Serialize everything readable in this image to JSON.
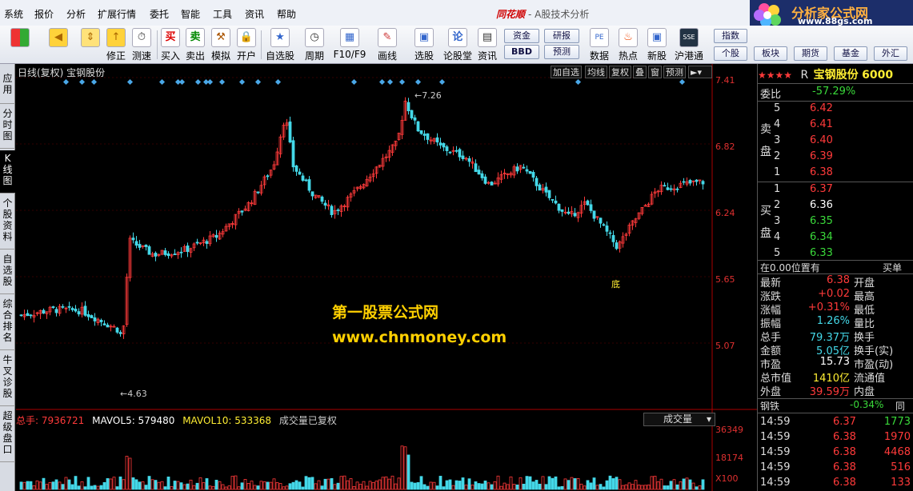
{
  "menu": [
    "系统",
    "报价",
    "分析",
    "扩展行情",
    "委托",
    "智能",
    "工具",
    "资讯",
    "帮助"
  ],
  "app_title": {
    "brand": "同花顺",
    "subtitle": "- A股技术分析"
  },
  "logo": {
    "title": "分析家公式网",
    "url": "www.88gs.com"
  },
  "toolbar": {
    "buttons": [
      {
        "label": "修正",
        "icon": "arrow-up-icon"
      },
      {
        "label": "测速",
        "icon": "stopwatch-icon"
      },
      {
        "label": "买入",
        "icon": "buy-icon"
      },
      {
        "label": "卖出",
        "icon": "sell-icon"
      },
      {
        "label": "模拟",
        "icon": "hammer-icon"
      },
      {
        "label": "开户",
        "icon": "lock-icon"
      },
      {
        "label": "自选股",
        "icon": "star-icon"
      },
      {
        "label": "周期",
        "icon": "clock-icon"
      },
      {
        "label": "F10/F9",
        "icon": "f10-icon"
      },
      {
        "label": "画线",
        "icon": "pencil-icon"
      },
      {
        "label": "选股",
        "icon": "select-stock-icon"
      },
      {
        "label": "论股堂",
        "icon": "forum-icon"
      },
      {
        "label": "资讯",
        "icon": "news-icon"
      },
      {
        "label": "数据",
        "icon": "data-icon"
      },
      {
        "label": "热点",
        "icon": "hot-icon"
      },
      {
        "label": "新股",
        "icon": "new-stock-icon"
      },
      {
        "label": "沪港通",
        "icon": "hk-connect-icon"
      }
    ],
    "small_buttons": [
      "资金",
      "BBD",
      "研报",
      "预测"
    ],
    "right_buttons": [
      "指数",
      "个股",
      "板块",
      "期货",
      "基金",
      "外汇"
    ]
  },
  "left_nav": [
    "应用",
    "分时图",
    "K线图",
    "个股资料",
    "自选股",
    "综合排名",
    "牛叉诊股",
    "超级盘口"
  ],
  "chart": {
    "title": "日线(复权)  宝钢股份",
    "tabs": [
      "加自选",
      "均线",
      "复权",
      "叠",
      "窗",
      "预测"
    ],
    "price_axis": [
      "7.41",
      "6.82",
      "6.24",
      "5.65",
      "5.07"
    ],
    "volume_axis": [
      "36349",
      "18174",
      "X100"
    ],
    "high_label": "7.26",
    "low_label": "4.63",
    "bottom_marker": "底",
    "volume_header": {
      "total": "总手: 7936721",
      "mavol5": "MAVOL5: 579480",
      "mavol10": "MAVOL10: 533368",
      "note": "成交量已复权"
    },
    "volume_select": "成交量",
    "watermark": {
      "line1": "第一股票公式网",
      "line2": "www.chnmoney.com"
    }
  },
  "quote": {
    "stars": "★★★★",
    "marker": "R",
    "name": "宝钢股份",
    "code": "6000",
    "weibi_label": "委比",
    "weibi_value": "-57.29%",
    "sell_label": "卖盘",
    "buy_label": "买盘",
    "sells": [
      {
        "level": "5",
        "price": "6.42"
      },
      {
        "level": "4",
        "price": "6.41"
      },
      {
        "level": "3",
        "price": "6.40"
      },
      {
        "level": "2",
        "price": "6.39"
      },
      {
        "level": "1",
        "price": "6.38"
      }
    ],
    "buys": [
      {
        "level": "1",
        "price": "6.37"
      },
      {
        "level": "2",
        "price": "6.36"
      },
      {
        "level": "3",
        "price": "6.35"
      },
      {
        "level": "4",
        "price": "6.34"
      },
      {
        "level": "5",
        "price": "6.33"
      }
    ],
    "position_note": "在0.00位置有",
    "position_side": "买单",
    "stats": [
      {
        "label": "最新",
        "value": "6.38",
        "label2": "开盘"
      },
      {
        "label": "涨跌",
        "value": "+0.02",
        "label2": "最高"
      },
      {
        "label": "涨幅",
        "value": "+0.31%",
        "label2": "最低"
      },
      {
        "label": "振幅",
        "value": "1.26%",
        "label2": "量比"
      },
      {
        "label": "总手",
        "value": "79.37万",
        "label2": "换手"
      },
      {
        "label": "金额",
        "value": "5.05亿",
        "label2": "换手(实)"
      },
      {
        "label": "市盈",
        "value": "15.73",
        "label2": "市盈(动)"
      },
      {
        "label": "总市值",
        "value": "1410亿",
        "label2": "流通值"
      },
      {
        "label": "外盘",
        "value": "39.59万",
        "label2": "内盘"
      }
    ],
    "sector_name": "钢铁",
    "sector_change": "-0.34%",
    "sector_extra": "同",
    "ticks": [
      {
        "time": "14:59",
        "price": "6.37",
        "vol": "1773"
      },
      {
        "time": "14:59",
        "price": "6.38",
        "vol": "1970"
      },
      {
        "time": "14:59",
        "price": "6.38",
        "vol": "4468"
      },
      {
        "time": "14:59",
        "price": "6.38",
        "vol": "516"
      },
      {
        "time": "14:59",
        "price": "6.38",
        "vol": "133"
      }
    ]
  },
  "colors": {
    "up": "#ff3a3a",
    "down": "#44d8e8",
    "background": "#000000",
    "highlight": "#ffee33"
  },
  "chart_data": {
    "type": "candlestick",
    "price_ylim": [
      4.6,
      7.45
    ],
    "high": 7.26,
    "low": 4.63
  }
}
